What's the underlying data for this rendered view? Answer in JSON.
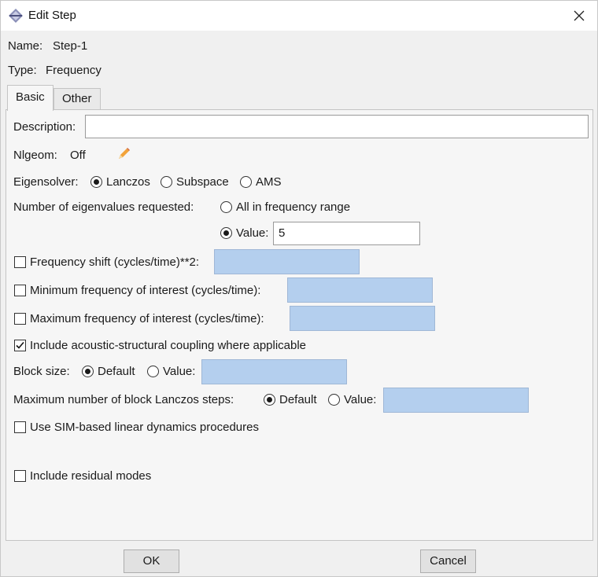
{
  "window": {
    "title": "Edit Step"
  },
  "step": {
    "name_label": "Name:",
    "name_value": "Step-1",
    "type_label": "Type:",
    "type_value": "Frequency"
  },
  "tabs": [
    {
      "label": "Basic",
      "active": true
    },
    {
      "label": "Other",
      "active": false
    }
  ],
  "basic": {
    "description_label": "Description:",
    "description_value": "",
    "nlgeom_label": "Nlgeom:",
    "nlgeom_value": "Off",
    "eigensolver": {
      "label": "Eigensolver:",
      "options": [
        "Lanczos",
        "Subspace",
        "AMS"
      ],
      "selected": "Lanczos"
    },
    "eigenvalues": {
      "label": "Number of eigenvalues requested:",
      "option_all": "All in frequency range",
      "option_value": "Value:",
      "selected": "Value",
      "value": "5"
    },
    "frequency_shift": {
      "label": "Frequency shift (cycles/time)**2:",
      "checked": false,
      "value": ""
    },
    "min_frequency": {
      "label": "Minimum frequency of interest (cycles/time):",
      "checked": false,
      "value": ""
    },
    "max_frequency": {
      "label": "Maximum frequency of interest (cycles/time):",
      "checked": false,
      "value": ""
    },
    "acoustic_coupling": {
      "label": "Include acoustic-structural coupling where applicable",
      "checked": true
    },
    "block_size": {
      "label": "Block size:",
      "option_default": "Default",
      "option_value": "Value:",
      "selected": "Default",
      "value": ""
    },
    "max_block_lanczos": {
      "label": "Maximum number of block Lanczos steps:",
      "option_default": "Default",
      "option_value": "Value:",
      "selected": "Default",
      "value": ""
    },
    "sim_based": {
      "label": "Use SIM-based linear dynamics procedures",
      "checked": false
    },
    "residual_modes": {
      "label": "Include residual modes",
      "checked": false
    }
  },
  "buttons": {
    "ok": "OK",
    "cancel": "Cancel"
  },
  "colors": {
    "inactive_field": "#b4cfee",
    "dialog_bg": "#f0f0f0"
  }
}
